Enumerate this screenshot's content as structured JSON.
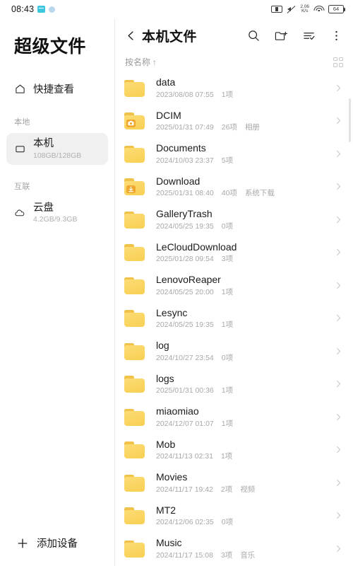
{
  "statusbar": {
    "time": "08:43",
    "left_icons": [
      "message-icon",
      "app-dot-icon"
    ],
    "net_speed_value": "2.06",
    "net_speed_unit": "K/s",
    "battery_level": "64",
    "right_icons": [
      "sim-card-icon",
      "mute-icon",
      "network-speed-icon",
      "wifi-icon",
      "battery-icon"
    ]
  },
  "sidebar": {
    "app_title": "超级文件",
    "quick_view": {
      "label": "快捷查看",
      "icon": "home-icon"
    },
    "sections": [
      {
        "title": "本地",
        "items": [
          {
            "label": "本机",
            "capacity": "108GB/128GB",
            "icon": "device-icon",
            "selected": true
          }
        ]
      },
      {
        "title": "互联",
        "items": [
          {
            "label": "云盘",
            "capacity": "4.2GB/9.3GB",
            "icon": "cloud-icon",
            "selected": false
          }
        ]
      }
    ],
    "add_device": {
      "label": "添加设备",
      "icon": "plus-icon"
    }
  },
  "main": {
    "title": "本机文件",
    "back_icon": "chevron-left-icon",
    "actions": [
      {
        "name": "search-icon",
        "label": "搜索"
      },
      {
        "name": "new-folder-icon",
        "label": "新建文件夹"
      },
      {
        "name": "sort-filter-icon",
        "label": "排序筛选"
      },
      {
        "name": "more-options-icon",
        "label": "更多"
      }
    ],
    "sort_label": "按名称",
    "sort_arrow": "↑",
    "grid_toggle_icon": "grid-view-icon",
    "files": [
      {
        "name": "data",
        "date": "2023/08/08 07:55",
        "count": "1项",
        "tag": "",
        "icon": "folder-icon"
      },
      {
        "name": "DCIM",
        "date": "2025/01/31 07:49",
        "count": "26项",
        "tag": "相册",
        "icon": "folder-camera-icon"
      },
      {
        "name": "Documents",
        "date": "2024/10/03 23:37",
        "count": "5项",
        "tag": "",
        "icon": "folder-icon"
      },
      {
        "name": "Download",
        "date": "2025/01/31 08:40",
        "count": "40项",
        "tag": "系统下载",
        "icon": "folder-download-icon"
      },
      {
        "name": "GalleryTrash",
        "date": "2024/05/25 19:35",
        "count": "0项",
        "tag": "",
        "icon": "folder-icon"
      },
      {
        "name": "LeCloudDownload",
        "date": "2025/01/28 09:54",
        "count": "3项",
        "tag": "",
        "icon": "folder-icon"
      },
      {
        "name": "LenovoReaper",
        "date": "2024/05/25 20:00",
        "count": "1项",
        "tag": "",
        "icon": "folder-icon"
      },
      {
        "name": "Lesync",
        "date": "2024/05/25 19:35",
        "count": "1项",
        "tag": "",
        "icon": "folder-icon"
      },
      {
        "name": "log",
        "date": "2024/10/27 23:54",
        "count": "0项",
        "tag": "",
        "icon": "folder-icon"
      },
      {
        "name": "logs",
        "date": "2025/01/31 00:36",
        "count": "1项",
        "tag": "",
        "icon": "folder-icon"
      },
      {
        "name": "miaomiao",
        "date": "2024/12/07 01:07",
        "count": "1项",
        "tag": "",
        "icon": "folder-icon"
      },
      {
        "name": "Mob",
        "date": "2024/11/13 02:31",
        "count": "1项",
        "tag": "",
        "icon": "folder-icon"
      },
      {
        "name": "Movies",
        "date": "2024/11/17 19:42",
        "count": "2项",
        "tag": "视频",
        "icon": "folder-icon"
      },
      {
        "name": "MT2",
        "date": "2024/12/06 02:35",
        "count": "0项",
        "tag": "",
        "icon": "folder-icon"
      },
      {
        "name": "Music",
        "date": "2024/11/17 15:08",
        "count": "3项",
        "tag": "音乐",
        "icon": "folder-icon"
      }
    ]
  },
  "colors": {
    "folder_body": "#fcd766",
    "folder_tab": "#f0c24a",
    "badge": "#f0a82e",
    "selected_bg": "#f0f0f0",
    "text_primary": "#1b1b1b",
    "text_muted": "#a8a8a8"
  }
}
